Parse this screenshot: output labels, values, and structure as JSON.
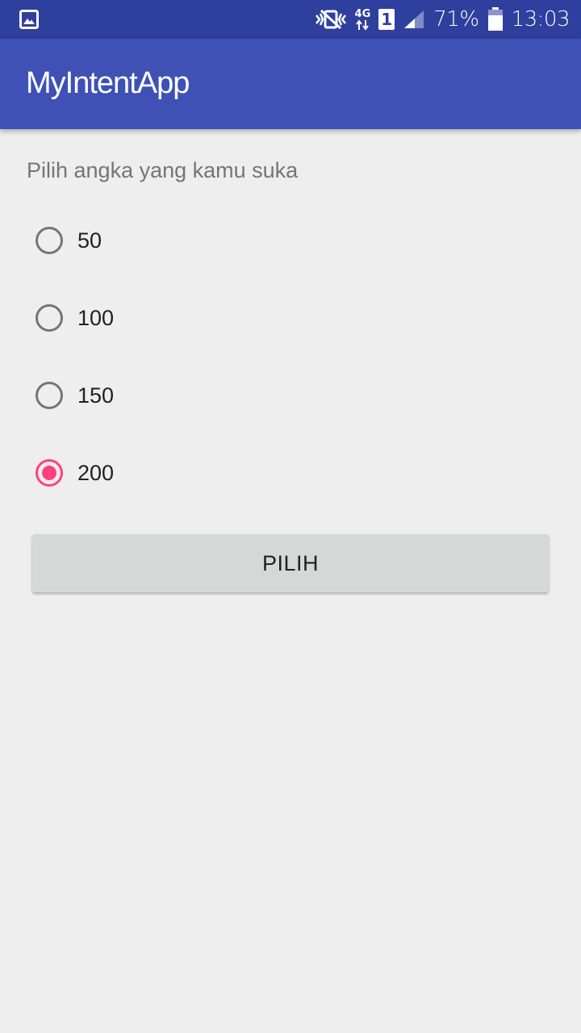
{
  "status_bar": {
    "left_icon": "gallery-icon",
    "mute_icon": "vibrate-icon",
    "network_label": "4G",
    "sim_label": "1",
    "signal_icon": "signal-icon",
    "battery_percent": "71%",
    "battery_icon": "battery-icon",
    "time": "13:03"
  },
  "app_bar": {
    "title": "MyIntentApp"
  },
  "main": {
    "prompt": "Pilih angka yang kamu suka",
    "options": [
      {
        "label": "50",
        "checked": false
      },
      {
        "label": "100",
        "checked": false
      },
      {
        "label": "150",
        "checked": false
      },
      {
        "label": "200",
        "checked": true
      }
    ],
    "button_label": "PILIH"
  },
  "colors": {
    "status_bar": "#2f3f9e",
    "app_bar": "#3f51b5",
    "accent": "#ff4081",
    "background": "#eeeeee",
    "button": "#d6d7d7"
  }
}
